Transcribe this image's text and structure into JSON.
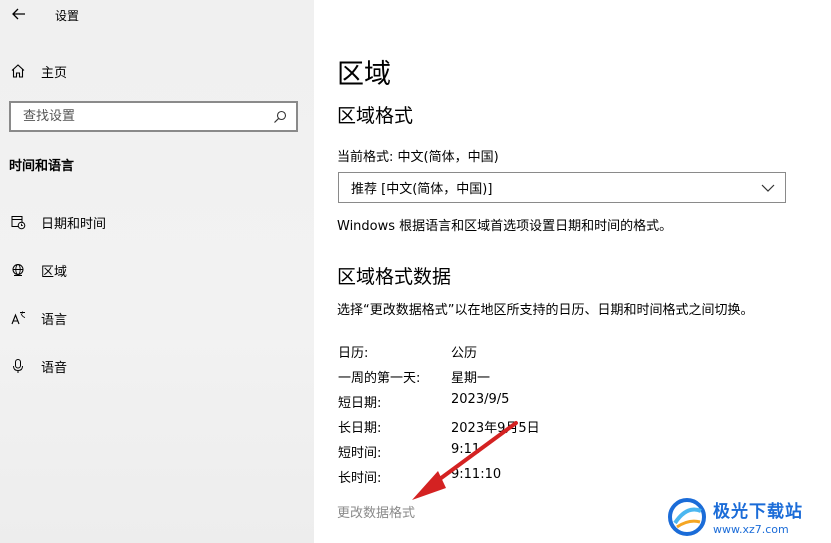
{
  "window": {
    "title": "设置"
  },
  "sidebar": {
    "home_label": "主页",
    "search_placeholder": "查找设置",
    "section_title": "时间和语言",
    "items": [
      {
        "label": "日期和时间",
        "icon": "calendar-clock-icon"
      },
      {
        "label": "区域",
        "icon": "globe-icon"
      },
      {
        "label": "语言",
        "icon": "language-icon"
      },
      {
        "label": "语音",
        "icon": "microphone-icon"
      }
    ]
  },
  "main": {
    "page_title": "区域",
    "region_format": {
      "heading": "区域格式",
      "current_format": "当前格式: 中文(简体，中国)",
      "dropdown_value": "推荐 [中文(简体，中国)]",
      "description": "Windows 根据语言和区域首选项设置日期和时间的格式。"
    },
    "format_data": {
      "heading": "区域格式数据",
      "description": "选择“更改数据格式”以在地区所支持的日历、日期和时间格式之间切换。",
      "rows": [
        {
          "label": "日历:",
          "value": "公历"
        },
        {
          "label": "一周的第一天:",
          "value": "星期一"
        },
        {
          "label": "短日期:",
          "value": "2023/9/5"
        },
        {
          "label": "长日期:",
          "value": "2023年9月5日"
        },
        {
          "label": "短时间:",
          "value": "9:11"
        },
        {
          "label": "长时间:",
          "value": "9:11:10"
        }
      ],
      "change_link": "更改数据格式"
    }
  },
  "watermark": {
    "name": "极光下载站",
    "url": "www.xz7.com"
  },
  "colors": {
    "arrow": "#d42222",
    "link_disabled": "#8a8a8a",
    "watermark": "#1b6cd8"
  }
}
